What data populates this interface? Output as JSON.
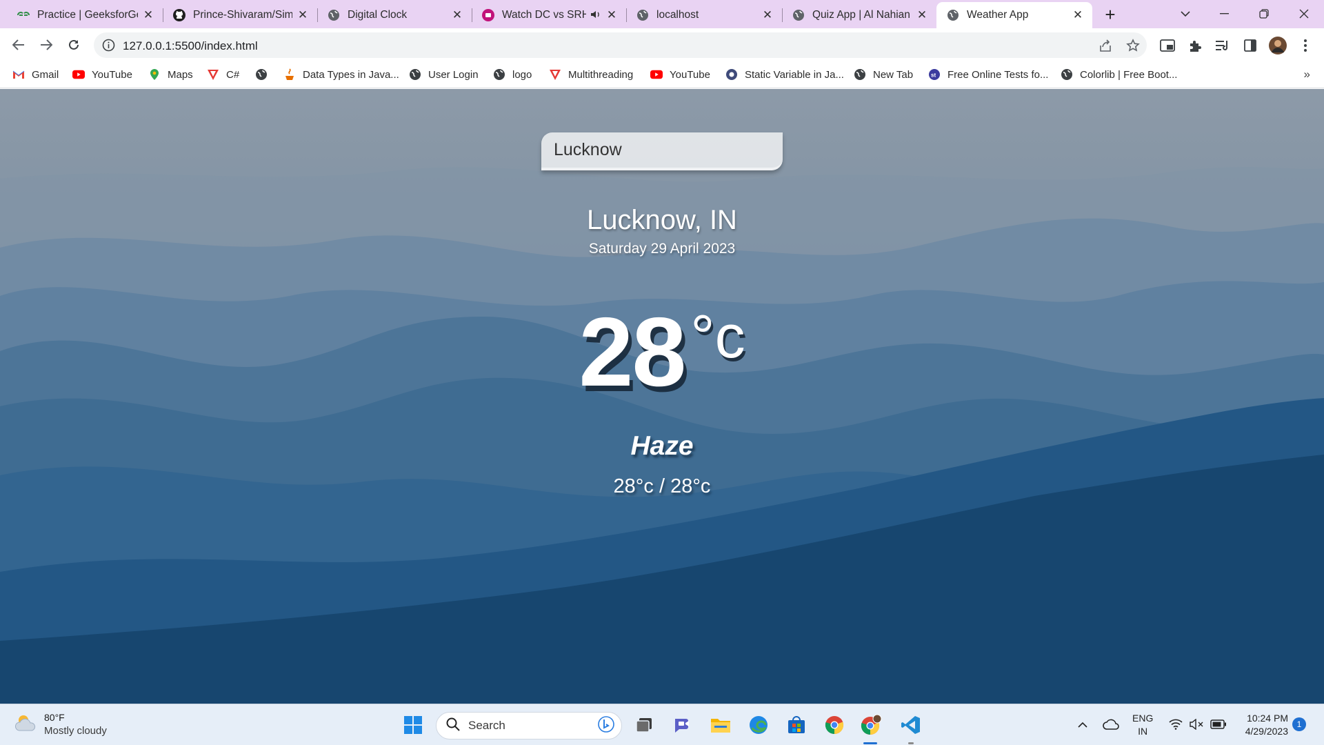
{
  "browser": {
    "tabs": [
      {
        "title": "Practice | GeeksforGeeks",
        "icon": "geeksforgeeks-icon"
      },
      {
        "title": "Prince-Shivaram/Simple",
        "icon": "github-icon"
      },
      {
        "title": "Digital Clock",
        "icon": "globe-icon"
      },
      {
        "title": "Watch DC vs SRH",
        "icon": "jiocinema-icon",
        "muted_icon": "speaker-icon"
      },
      {
        "title": "localhost",
        "icon": "globe-icon"
      },
      {
        "title": "Quiz App | Al Nahian",
        "icon": "globe-icon"
      },
      {
        "title": "Weather App",
        "icon": "globe-icon",
        "active": true
      }
    ],
    "url": "127.0.0.1:5500/index.html",
    "bookmarks": [
      {
        "label": "Gmail",
        "icon": "gmail-icon"
      },
      {
        "label": "YouTube",
        "icon": "youtube-icon"
      },
      {
        "label": "Maps",
        "icon": "maps-icon"
      },
      {
        "label": "C#",
        "icon": "red-v-icon"
      },
      {
        "label": "",
        "icon": "globe-icon"
      },
      {
        "label": "Data Types in Java...",
        "icon": "java-icon"
      },
      {
        "label": "User Login",
        "icon": "globe-icon"
      },
      {
        "label": "logo",
        "icon": "globe-icon"
      },
      {
        "label": "Multithreading",
        "icon": "red-v-icon"
      },
      {
        "label": "YouTube",
        "icon": "youtube-icon"
      },
      {
        "label": "Static Variable in Ja...",
        "icon": "dark-circle-icon"
      },
      {
        "label": "New Tab",
        "icon": "globe-icon"
      },
      {
        "label": "Free Online Tests fo...",
        "icon": "st-icon"
      },
      {
        "label": "Colorlib | Free Boot...",
        "icon": "globe-icon"
      }
    ]
  },
  "weather": {
    "search_value": "Lucknow",
    "location": "Lucknow, IN",
    "date": "Saturday 29 April 2023",
    "temperature": "28",
    "unit": "°c",
    "condition": "Haze",
    "hi_low": "28°c / 28°c"
  },
  "taskbar": {
    "weather_temp": "80°F",
    "weather_desc": "Mostly cloudy",
    "search_placeholder": "Search",
    "lang_line1": "ENG",
    "lang_line2": "IN",
    "time": "10:24 PM",
    "date": "4/29/2023",
    "notification_count": "1"
  },
  "colors": {
    "tab_strip": "#e9d3f3",
    "page_sky": "#8d9aa8",
    "page_deep": "#1d4a73",
    "taskbar": "#e6eef8",
    "accent": "#1f6fd1"
  }
}
